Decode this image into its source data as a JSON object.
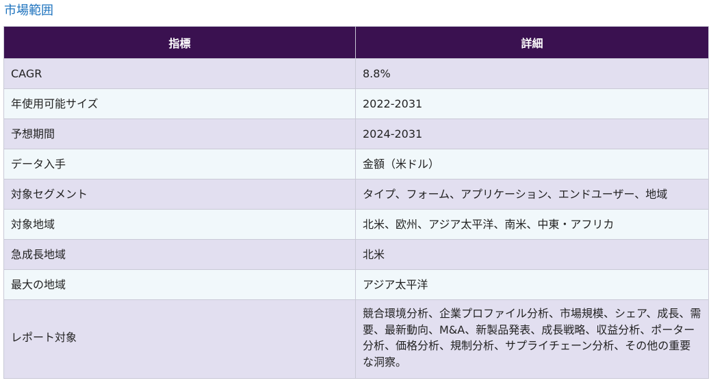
{
  "heading": "市場範囲",
  "table": {
    "headers": [
      "指標",
      "詳細"
    ],
    "rows": [
      {
        "metric": "CAGR",
        "detail": "8.8%"
      },
      {
        "metric": "年使用可能サイズ",
        "detail": "2022-2031"
      },
      {
        "metric": "予想期間",
        "detail": "2024-2031"
      },
      {
        "metric": "データ入手",
        "detail": "金額（米ドル）"
      },
      {
        "metric": "対象セグメント",
        "detail": "タイプ、フォーム、アプリケーション、エンドユーザー、地域"
      },
      {
        "metric": "対象地域",
        "detail": "北米、欧州、アジア太平洋、南米、中東・アフリカ"
      },
      {
        "metric": "急成長地域",
        "detail": "北米"
      },
      {
        "metric": "最大の地域",
        "detail": "アジア太平洋"
      },
      {
        "metric": "レポート対象",
        "detail": "競合環境分析、企業プロファイル分析、市場規模、シェア、成長、需要、最新動向、M&A、新製品発表、成長戦略、収益分析、ポーター分析、価格分析、規制分析、サプライチェーン分析、その他の重要な洞察。"
      }
    ]
  }
}
